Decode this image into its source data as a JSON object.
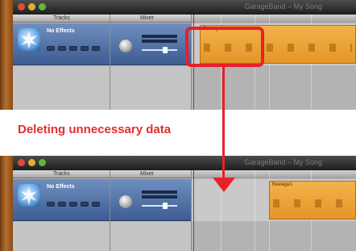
{
  "window": {
    "title": "GarageBand – My Song"
  },
  "header": {
    "tracks_label": "Tracks",
    "mixer_label": "Mixer"
  },
  "track": {
    "name": "No Effects",
    "icon": "no-effects-icon"
  },
  "region": {
    "label": "Beelage1"
  },
  "annotation": {
    "caption": "Deleting unnecessary data"
  },
  "colors": {
    "region": "#eba23a",
    "highlight": "#e8202a",
    "caption": "#e52d2d",
    "track_header": "#5676a9",
    "titlebar": "#2e2e2e"
  }
}
